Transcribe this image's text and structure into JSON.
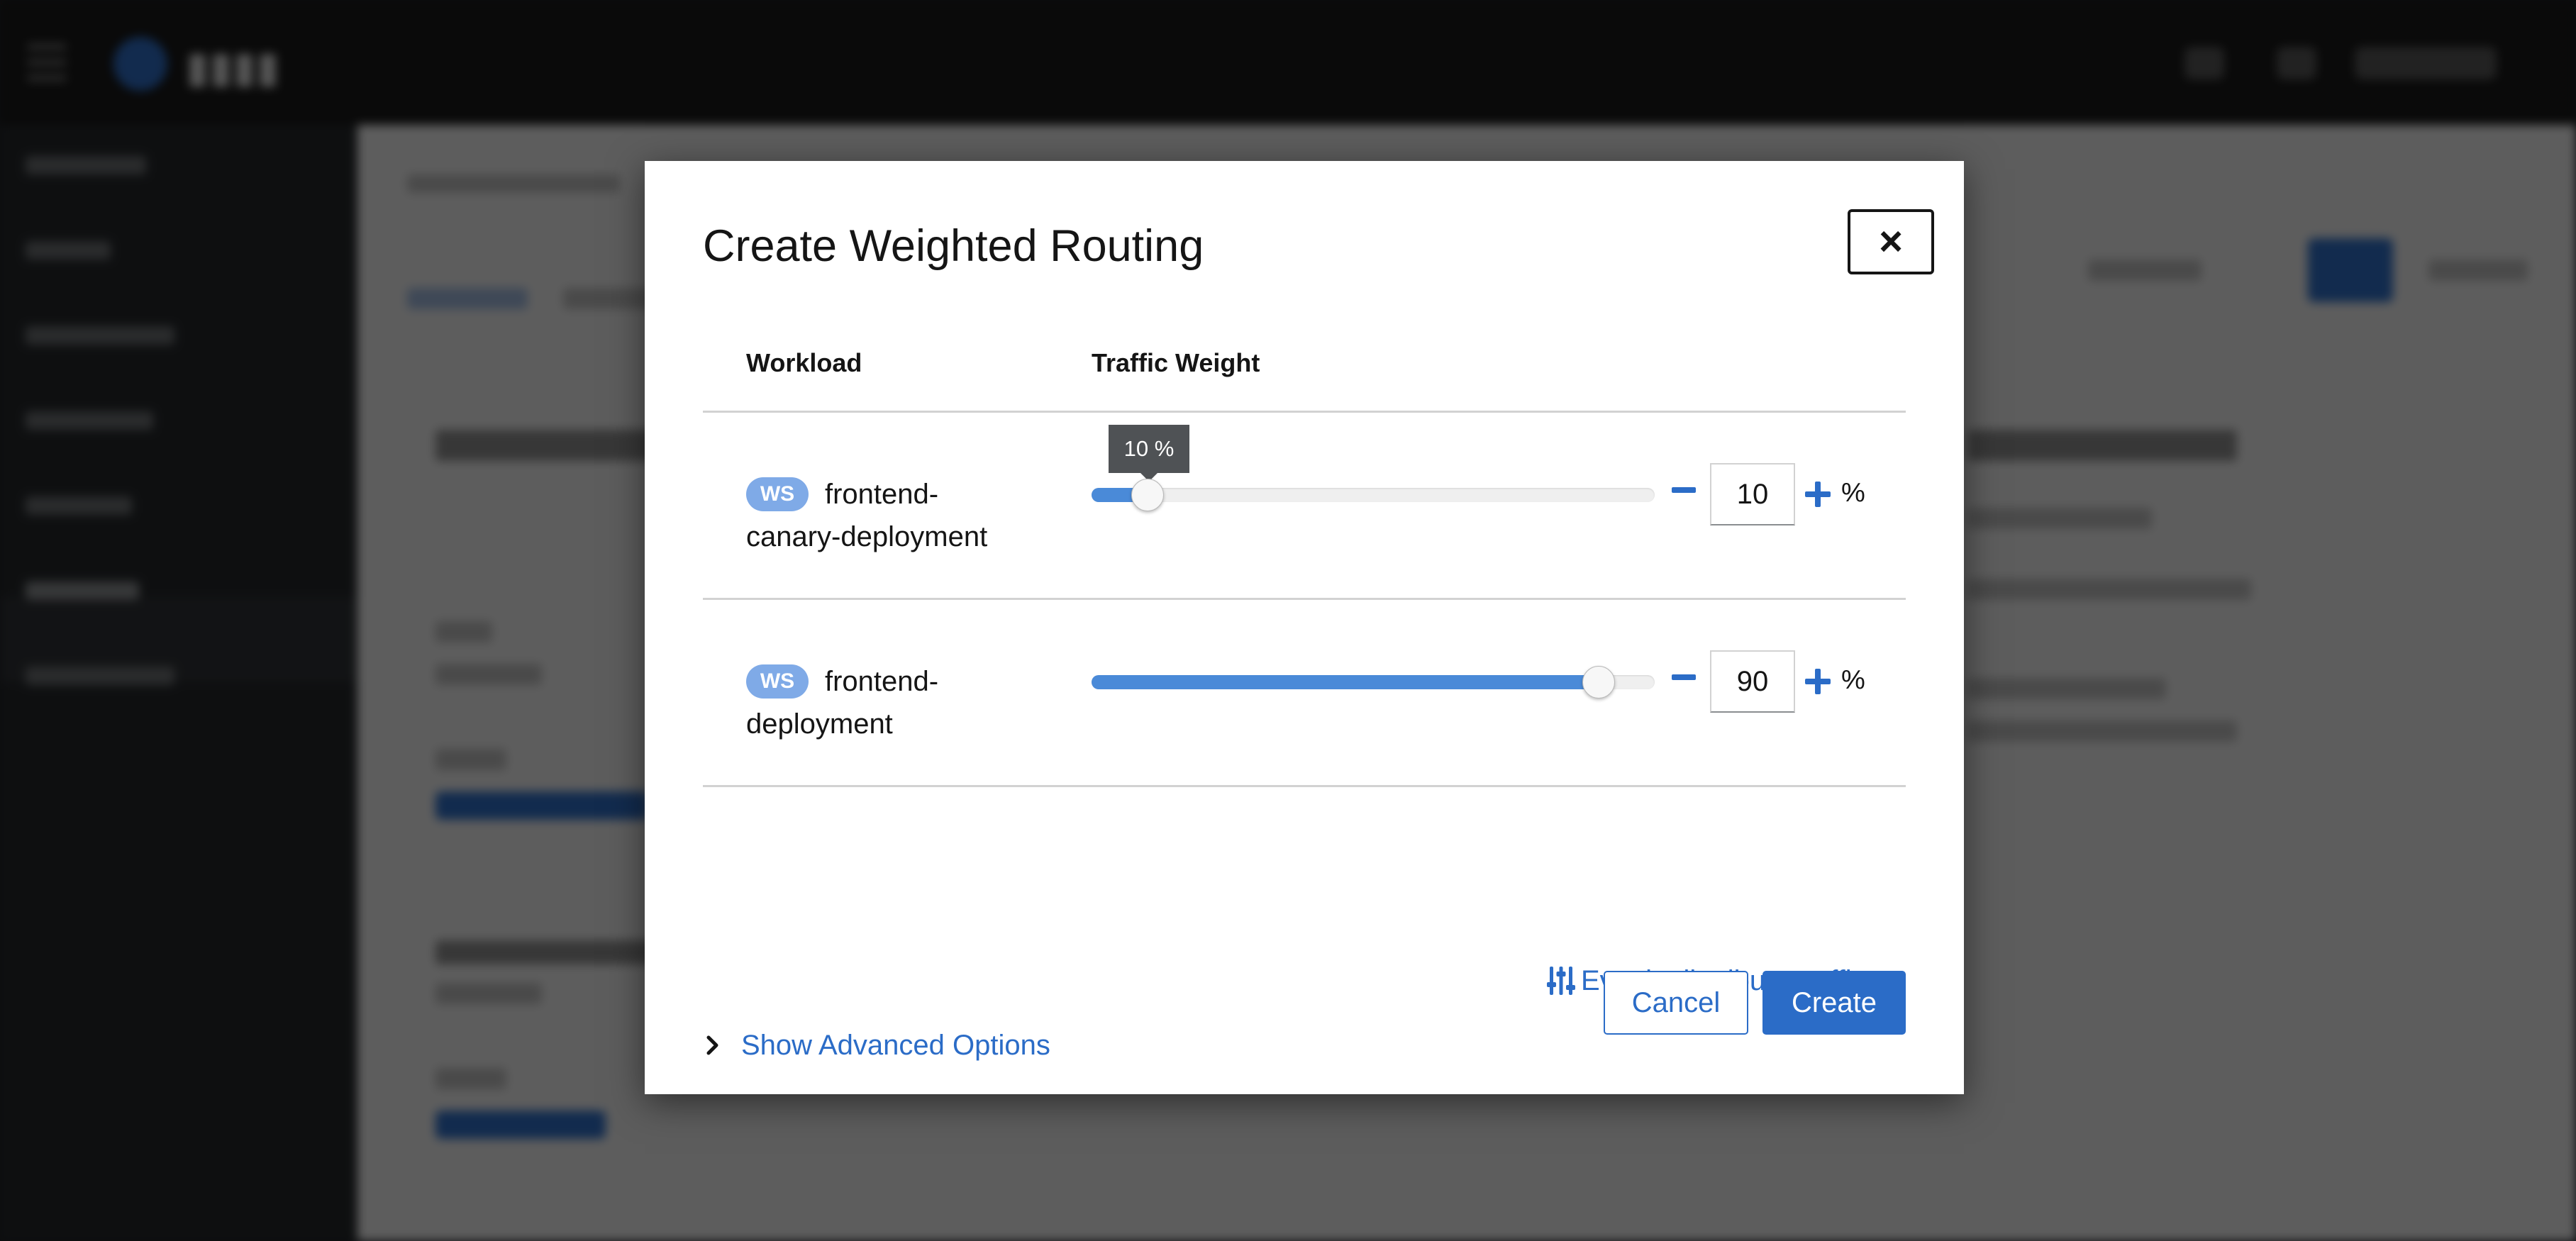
{
  "dialog": {
    "title": "Create Weighted Routing",
    "close_label": "×",
    "columns": {
      "workload": "Workload",
      "traffic_weight": "Traffic Weight"
    },
    "rows": [
      {
        "badge": "WS",
        "name_line1": "frontend-",
        "name_line2": "canary-deployment",
        "weight": "10",
        "weight_value": 10,
        "tooltip": "10 %",
        "unit": "%"
      },
      {
        "badge": "WS",
        "name_line1": "frontend-",
        "name_line2": "deployment",
        "weight": "90",
        "weight_value": 90,
        "unit": "%"
      }
    ],
    "evenly_distribute_label": "Evenly distribute traffic",
    "advanced_options_label": "Show Advanced Options",
    "cancel_label": "Cancel",
    "create_label": "Create"
  },
  "colors": {
    "accent": "#2b6cc7",
    "slider_fill": "#4a8ad8",
    "badge_bg": "#7faae7",
    "tooltip_bg": "#4f5255"
  },
  "icons": {
    "close": "close-icon",
    "minus": "minus-icon",
    "plus": "plus-icon",
    "distribute": "sliders-icon",
    "expand": "chevron-right-icon"
  }
}
